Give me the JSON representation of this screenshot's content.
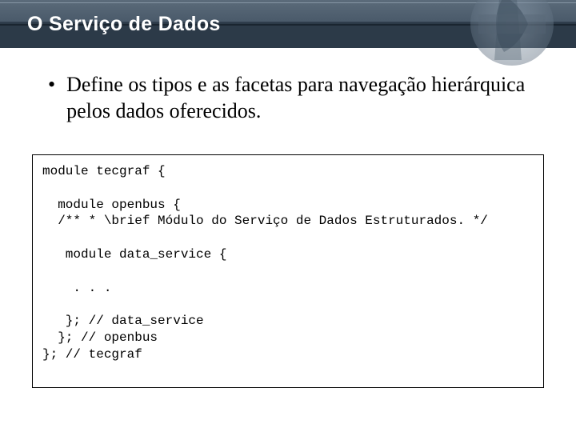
{
  "header": {
    "title": "O Serviço de Dados"
  },
  "bullet": {
    "marker": "•",
    "text": "Define os tipos e as facetas para navegação hierárquica pelos dados oferecidos."
  },
  "code": {
    "line1": "module tecgraf {",
    "line2": "",
    "line3": "  module openbus {",
    "line4": "  /** * \\brief Módulo do Serviço de Dados Estruturados. */",
    "line5": "",
    "line6": "   module data_service {",
    "line7": "",
    "line8": "    . . .",
    "line9": "",
    "line10": "   }; // data_service",
    "line11": "  }; // openbus",
    "line12": "}; // tecgraf"
  }
}
